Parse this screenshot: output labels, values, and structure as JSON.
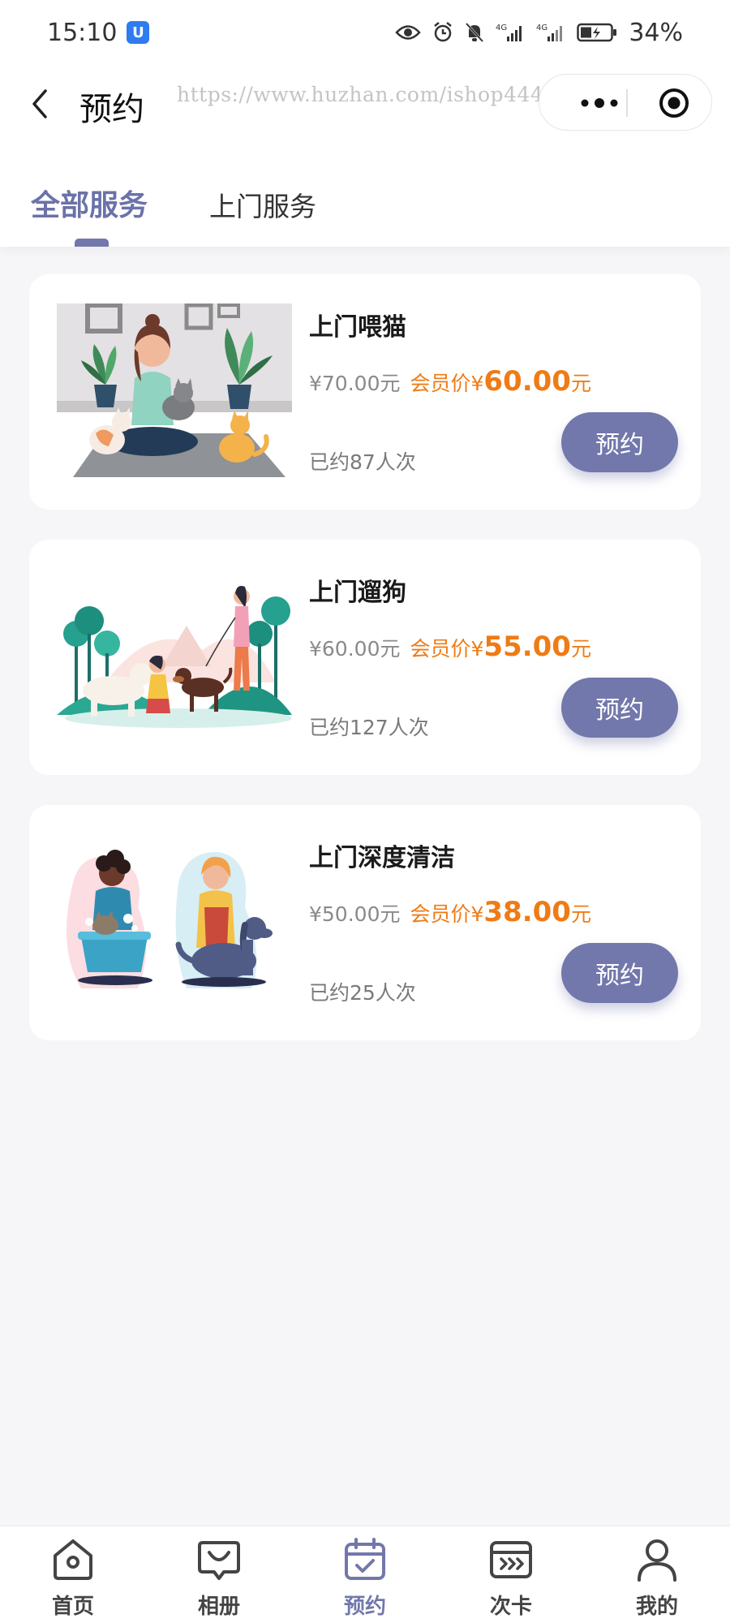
{
  "status_bar": {
    "time": "15:10",
    "battery": "34%"
  },
  "header": {
    "title": "预约",
    "watermark": "https://www.huzhan.com/ishop44453"
  },
  "tabs": [
    {
      "label": "全部服务",
      "active": true
    },
    {
      "label": "上门服务",
      "active": false
    }
  ],
  "services": [
    {
      "title": "上门喂猫",
      "original_price": "¥70.00元",
      "member_label": "会员价¥",
      "member_price": "60.00",
      "member_unit": "元",
      "booked": "已约87人次",
      "button": "预约"
    },
    {
      "title": "上门遛狗",
      "original_price": "¥60.00元",
      "member_label": "会员价¥",
      "member_price": "55.00",
      "member_unit": "元",
      "booked": "已约127人次",
      "button": "预约"
    },
    {
      "title": "上门深度清洁",
      "original_price": "¥50.00元",
      "member_label": "会员价¥",
      "member_price": "38.00",
      "member_unit": "元",
      "booked": "已约25人次",
      "button": "预约"
    }
  ],
  "tabbar": [
    {
      "label": "首页",
      "icon": "home-icon",
      "active": false
    },
    {
      "label": "相册",
      "icon": "album-icon",
      "active": false
    },
    {
      "label": "预约",
      "icon": "calendar-check-icon",
      "active": true
    },
    {
      "label": "次卡",
      "icon": "card-icon",
      "active": false
    },
    {
      "label": "我的",
      "icon": "user-icon",
      "active": false
    }
  ],
  "colors": {
    "accent": "#7278ab",
    "member_price": "#ef7b15",
    "background": "#f6f6f9"
  }
}
